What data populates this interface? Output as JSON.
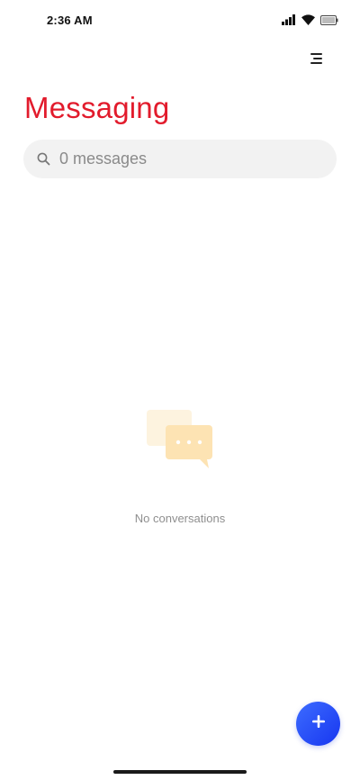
{
  "status_bar": {
    "time": "2:36 AM",
    "icons": [
      "signal-icon",
      "wifi-icon",
      "battery-icon"
    ]
  },
  "header": {
    "menu_icon": "menu-icon"
  },
  "page": {
    "title": "Messaging",
    "title_color": "#e21b2c"
  },
  "search": {
    "icon": "search-icon",
    "text": "0 messages"
  },
  "empty_state": {
    "illustration": "chat-bubbles-icon",
    "message": "No conversations"
  },
  "fab": {
    "icon": "plus-icon",
    "color": "#1f3ff5"
  }
}
